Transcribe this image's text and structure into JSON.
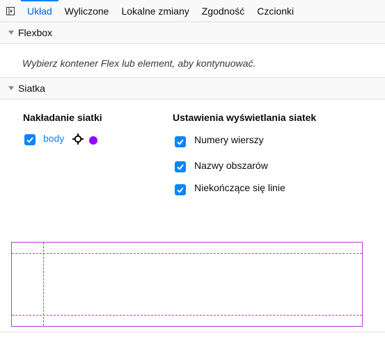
{
  "tabs": [
    {
      "label": "Układ",
      "active": true
    },
    {
      "label": "Wyliczone"
    },
    {
      "label": "Lokalne zmiany"
    },
    {
      "label": "Zgodność"
    },
    {
      "label": "Czcionki"
    }
  ],
  "flexbox": {
    "title": "Flexbox",
    "message": "Wybierz kontener Flex lub element, aby kontynuować."
  },
  "grid": {
    "title": "Siatka",
    "overlay": {
      "title": "Nakładanie siatki",
      "items": [
        {
          "label": "body",
          "checked": true,
          "color": "#9400ff",
          "icon": "crosshair-icon"
        }
      ]
    },
    "display_settings": {
      "title": "Ustawienia wyświetlania siatek",
      "options": [
        {
          "label": "Numery wierszy",
          "checked": true
        },
        {
          "label": "Nazwy obszarów",
          "checked": true
        },
        {
          "label": "Niekończące się linie",
          "checked": true
        }
      ]
    }
  },
  "colors": {
    "accent": "#0a84ff",
    "grid_outline": "#b53ccf",
    "grid_swatch": "#9400ff"
  }
}
